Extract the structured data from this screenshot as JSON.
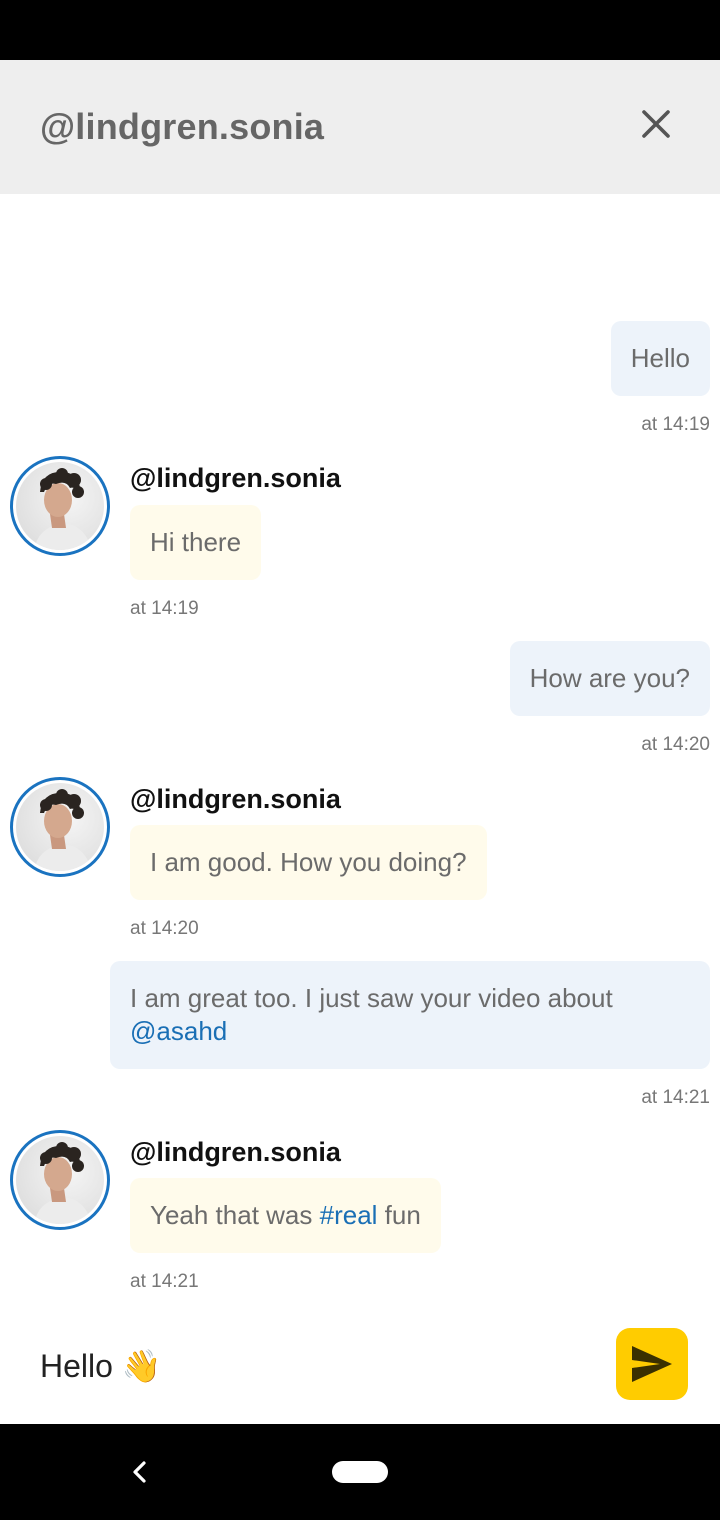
{
  "header": {
    "title": "@lindgren.sonia"
  },
  "messages": [
    {
      "direction": "out",
      "text": "Hello",
      "time": "at 14:19"
    },
    {
      "direction": "in",
      "sender": "@lindgren.sonia",
      "text": "Hi there",
      "time": "at 14:19"
    },
    {
      "direction": "out",
      "text": "How are you?",
      "time": "at 14:20"
    },
    {
      "direction": "in",
      "sender": "@lindgren.sonia",
      "text": "I am good. How you doing?",
      "time": "at 14:20"
    },
    {
      "direction": "out",
      "text_prefix": "I am great too. I just saw your video about",
      "mention": "@asahd",
      "time": "at 14:21"
    },
    {
      "direction": "in",
      "sender": "@lindgren.sonia",
      "text_prefix": "Yeah that was ",
      "hashtag": "#real",
      "text_suffix": " fun",
      "time": "at 14:21"
    }
  ],
  "composer": {
    "value": "Hello 👋"
  },
  "colors": {
    "accent": "#ffcc00",
    "link": "#1a6fb5",
    "outgoing_bubble": "#edf3fa",
    "incoming_bubble": "#fffbeb",
    "avatar_ring": "#1a73c0"
  },
  "icons": {
    "close": "close-icon",
    "send": "send-icon",
    "back": "nav-back-icon"
  }
}
